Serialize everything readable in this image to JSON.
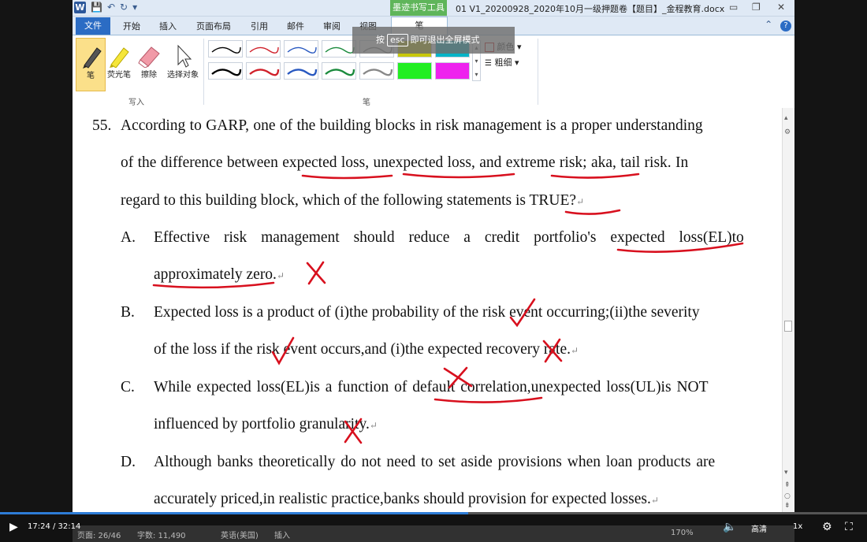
{
  "titlebar": {
    "context_tab": "墨迹书写工具",
    "doc_title": "01 V1_20200928_2020年10月一级押题卷【题目】_金程教育.docx"
  },
  "tabs": {
    "file": "文件",
    "home": "开始",
    "insert": "插入",
    "page_layout": "页面布局",
    "references": "引用",
    "mailings": "邮件",
    "review": "审阅",
    "view": "视图",
    "pen": "笔"
  },
  "ribbon": {
    "tools": [
      "笔",
      "荧光笔",
      "擦除",
      "选择对象"
    ],
    "write_group": "写入",
    "pen_group": "笔",
    "color_label": "颜色",
    "weight_label": "粗细",
    "pen_colors": [
      "#000000",
      "#d0202a",
      "#2858c0",
      "#1a8a3c",
      "#888888",
      "#c8c80a",
      "#00b4c8",
      "#000000",
      "#d0202a",
      "#2858c0",
      "#1a8a3c",
      "#888888",
      "#22ee22",
      "#ee22ee"
    ]
  },
  "esc_hint": {
    "prefix": "按",
    "key": "esc",
    "suffix": "即可退出全屏模式"
  },
  "document": {
    "q_number": "55.",
    "q_line1": "According to GARP, one of the building blocks in risk management is a proper understanding",
    "q_line2": "of the difference between expected loss, unexpected loss, and extreme risk; aka, tail risk. In",
    "q_line3": "regard to this building block, which of the following statements is TRUE?",
    "options": [
      {
        "letter": "A.",
        "line1": "Effective risk management should reduce a credit portfolio's expected loss(EL)to",
        "line2": "approximately zero."
      },
      {
        "letter": "B.",
        "line1": "Expected loss is a product of (i)the probability of the risk event occurring;(ii)the severity",
        "line2": "of the loss if the risk event occurs,and (i)the expected recovery rate."
      },
      {
        "letter": "C.",
        "line1": "While expected loss(EL)is a function of default correlation,unexpected loss(UL)is NOT",
        "line2": "influenced by portfolio granularity."
      },
      {
        "letter": "D.",
        "line1": "Although banks theoretically do not need to set aside provisions when loan products are",
        "line2": "accurately priced,in realistic practice,banks should provision for expected losses."
      }
    ],
    "para_mark": "↵"
  },
  "status": {
    "page": "页面: 26/46",
    "words": "字数: 11,490",
    "language": "英语(美国)",
    "mode": "插入",
    "zoom": "170%"
  },
  "player": {
    "time": "17:24 / 32:14",
    "quality": "高清",
    "speed": "1x",
    "progress": 0.54
  }
}
